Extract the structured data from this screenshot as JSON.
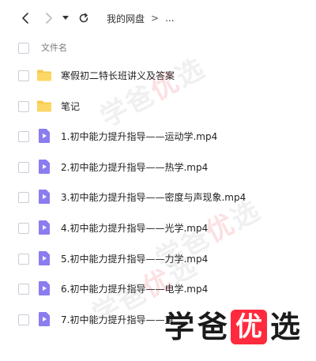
{
  "toolbar": {
    "back_icon": "chevron-left-icon",
    "forward_icon": "chevron-right-icon",
    "dropdown_icon": "caret-down-icon",
    "refresh_icon": "refresh-icon",
    "breadcrumb": {
      "root": "我的网盘",
      "separator": ">",
      "more": "..."
    }
  },
  "table": {
    "column_name": "文件名"
  },
  "files": [
    {
      "name": "寒假初二特长班讲义及答案",
      "type": "folder"
    },
    {
      "name": "笔记",
      "type": "folder"
    },
    {
      "name": "1.初中能力提升指导——运动学.mp4",
      "type": "video"
    },
    {
      "name": "2.初中能力提升指导——热学.mp4",
      "type": "video"
    },
    {
      "name": "3.初中能力提升指导——密度与声现象.mp4",
      "type": "video"
    },
    {
      "name": "4.初中能力提升指导——光学.mp4",
      "type": "video"
    },
    {
      "name": "5.初中能力提升指导——力学.mp4",
      "type": "video"
    },
    {
      "name": "6.初中能力提升指导——电学.mp4",
      "type": "video"
    },
    {
      "name": "7.初中能力提升指导——直",
      "type": "video"
    }
  ],
  "watermark": {
    "text_a": "学爸",
    "text_b": "优",
    "text_c": "选"
  },
  "brand": {
    "char1": "学",
    "char2": "爸",
    "char3": "优",
    "char4": "选"
  },
  "colors": {
    "folder": "#f7c94b",
    "video_icon": "#8b7cf0",
    "brand_red": "#ff2a3d"
  }
}
